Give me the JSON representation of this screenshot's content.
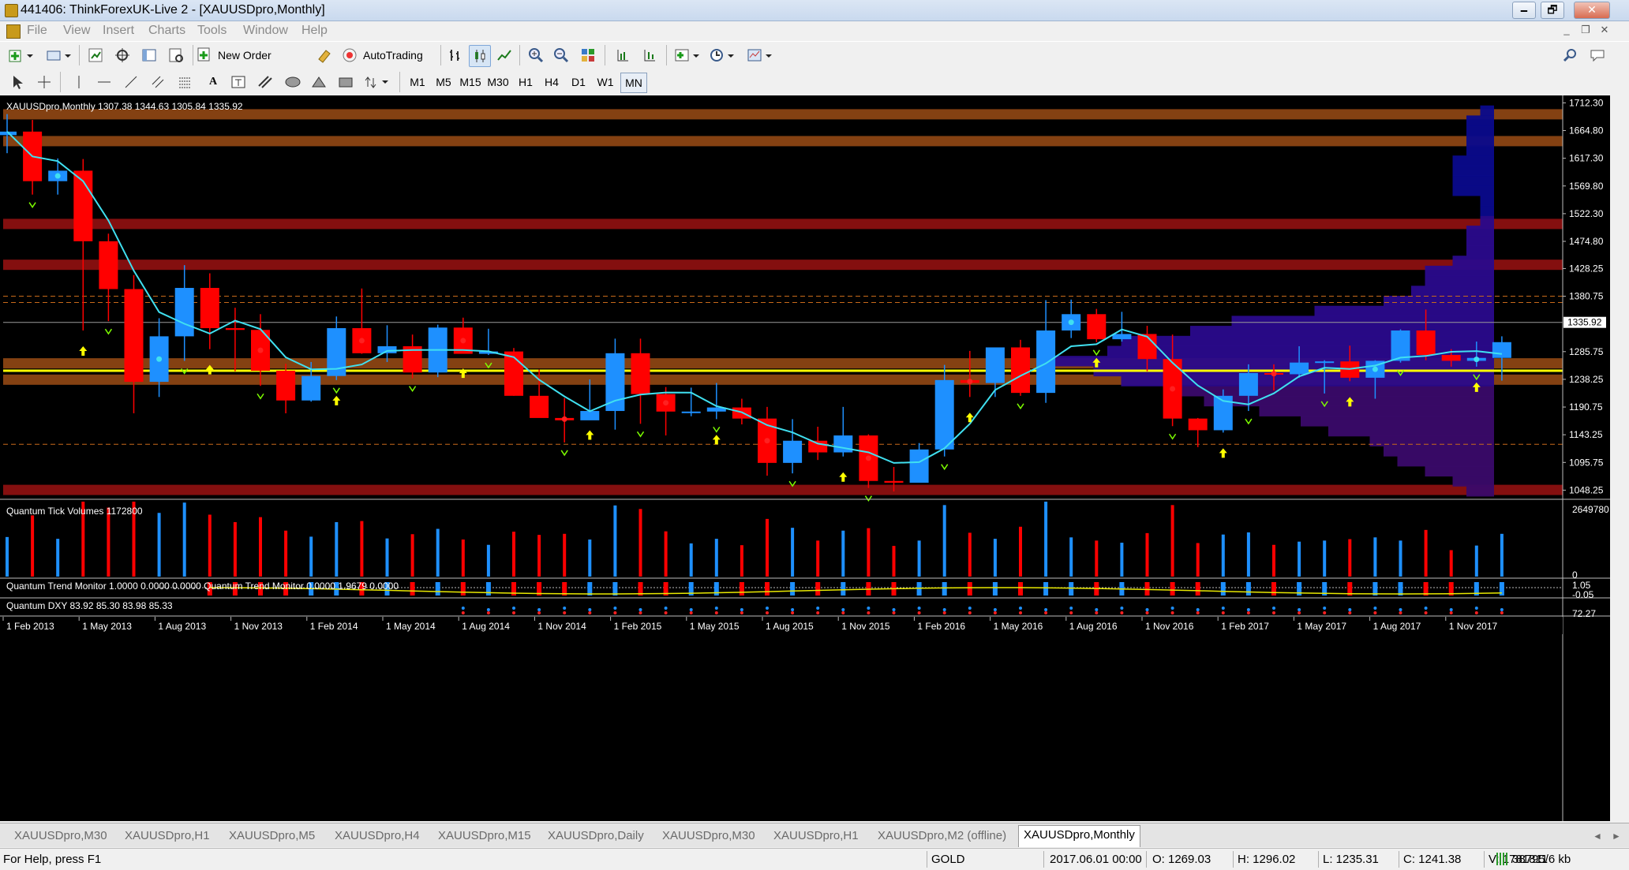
{
  "window": {
    "title": "441406: ThinkForexUK-Live 2 - [XAUUSDpro,Monthly]",
    "min": "🗕",
    "restore": "🗗",
    "close": "✕"
  },
  "menu": [
    "File",
    "View",
    "Insert",
    "Charts",
    "Tools",
    "Window",
    "Help"
  ],
  "toolbar": {
    "new_order": "New Order",
    "autotrading": "AutoTrading"
  },
  "timeframes": [
    "M1",
    "M5",
    "M15",
    "M30",
    "H1",
    "H4",
    "D1",
    "W1",
    "MN"
  ],
  "active_timeframe": "MN",
  "chart": {
    "header": "XAUUSDpro,Monthly  1307.38 1344.63 1305.84 1335.92",
    "current_price": "1335.92",
    "price_ticks": [
      "1712.30",
      "1664.80",
      "1617.30",
      "1569.80",
      "1522.30",
      "1474.80",
      "1428.25",
      "1380.75",
      "1285.75",
      "1238.25",
      "1190.75",
      "1143.25",
      "1095.75",
      "1048.25"
    ],
    "date_labels": [
      "1 Feb 2013",
      "1 May 2013",
      "1 Aug 2013",
      "1 Nov 2013",
      "1 Feb 2014",
      "1 May 2014",
      "1 Aug 2014",
      "1 Nov 2014",
      "1 Feb 2015",
      "1 May 2015",
      "1 Aug 2015",
      "1 Nov 2015",
      "1 Feb 2016",
      "1 May 2016",
      "1 Aug 2016",
      "1 Nov 2016",
      "1 Feb 2017",
      "1 May 2017",
      "1 Aug 2017",
      "1 Nov 2017"
    ]
  },
  "indicators": {
    "volume": {
      "label": "Quantum Tick Volumes 1172800",
      "max": "2649780",
      "zero": "0"
    },
    "trend": {
      "label": "Quantum Trend Monitor 1.0000 0.0000 0.0000   Quantum Trend Monitor 0.0000 1.9679 0.0000",
      "hi": "1.05",
      "lo": "-0.05"
    },
    "dxy": {
      "label": "Quantum DXY 83.92 85.30 83.98 85.33",
      "value": "72.27"
    }
  },
  "tabs": [
    "XAUUSDpro,M30",
    "XAUUSDpro,H1",
    "XAUUSDpro,M5",
    "XAUUSDpro,H4",
    "XAUUSDpro,M15",
    "XAUUSDpro,Daily",
    "XAUUSDpro,M30",
    "XAUUSDpro,H1",
    "XAUUSDpro,M2 (offline)",
    "XAUUSDpro,Monthly"
  ],
  "active_tab": 9,
  "status": {
    "help": "For Help, press F1",
    "profile": "GOLD",
    "time": "2017.06.01 00:00",
    "open": "O: 1269.03",
    "high": "H: 1296.02",
    "low": "L: 1235.31",
    "close": "C: 1241.38",
    "volume": "V: 1781811",
    "traffic": "38795/6 kb"
  },
  "chart_data": {
    "type": "candlestick",
    "categories": [
      "Jan 2013",
      "Feb 2013",
      "Mar 2013",
      "Apr 2013",
      "May 2013",
      "Jun 2013",
      "Jul 2013",
      "Aug 2013",
      "Sep 2013",
      "Oct 2013",
      "Nov 2013",
      "Dec 2013",
      "Jan 2014",
      "Feb 2014",
      "Mar 2014",
      "Apr 2014",
      "May 2014",
      "Jun 2014",
      "Jul 2014",
      "Aug 2014",
      "Sep 2014",
      "Oct 2014",
      "Nov 2014",
      "Dec 2014",
      "Jan 2015",
      "Feb 2015",
      "Mar 2015",
      "Apr 2015",
      "May 2015",
      "Jun 2015",
      "Jul 2015",
      "Aug 2015",
      "Sep 2015",
      "Oct 2015",
      "Nov 2015",
      "Dec 2015",
      "Jan 2016",
      "Feb 2016",
      "Mar 2016",
      "Apr 2016",
      "May 2016",
      "Jun 2016",
      "Jul 2016",
      "Aug 2016",
      "Sep 2016",
      "Oct 2016",
      "Nov 2016",
      "Dec 2016",
      "Jan 2017",
      "Feb 2017",
      "Mar 2017",
      "Apr 2017",
      "May 2017",
      "Jun 2017",
      "Jul 2017",
      "Aug 2017",
      "Sep 2017",
      "Oct 2017",
      "Nov 2017",
      "Dec 2017"
    ],
    "open": [
      1657,
      1663,
      1578,
      1596,
      1475,
      1393,
      1234,
      1312,
      1395,
      1326,
      1323,
      1253,
      1202,
      1244,
      1326,
      1283,
      1295,
      1250,
      1327,
      1282,
      1286,
      1210,
      1172,
      1168,
      1184,
      1283,
      1213,
      1183,
      1183,
      1190,
      1171,
      1095,
      1133,
      1113,
      1142,
      1064,
      1061,
      1118,
      1237,
      1232,
      1293,
      1215,
      1322,
      1350,
      1307,
      1316,
      1273,
      1171,
      1151,
      1210,
      1249,
      1247,
      1267,
      1269,
      1241,
      1270,
      1322,
      1280,
      1270,
      1275
    ],
    "high": [
      1693,
      1683,
      1617,
      1616,
      1488,
      1417,
      1343,
      1434,
      1420,
      1361,
      1350,
      1265,
      1268,
      1346,
      1394,
      1331,
      1315,
      1332,
      1344,
      1325,
      1292,
      1255,
      1206,
      1238,
      1308,
      1308,
      1225,
      1224,
      1232,
      1205,
      1191,
      1170,
      1157,
      1191,
      1144,
      1088,
      1129,
      1263,
      1287,
      1270,
      1306,
      1374,
      1375,
      1359,
      1354,
      1330,
      1315,
      1172,
      1221,
      1264,
      1264,
      1295,
      1271,
      1296,
      1271,
      1324,
      1358,
      1290,
      1303,
      1312
    ],
    "low": [
      1626,
      1555,
      1555,
      1322,
      1338,
      1180,
      1208,
      1270,
      1290,
      1252,
      1227,
      1180,
      1200,
      1237,
      1282,
      1268,
      1240,
      1242,
      1284,
      1280,
      1210,
      1182,
      1130,
      1178,
      1152,
      1162,
      1142,
      1175,
      1170,
      1161,
      1073,
      1077,
      1100,
      1106,
      1052,
      1046,
      1072,
      1106,
      1208,
      1208,
      1210,
      1198,
      1309,
      1302,
      1303,
      1252,
      1158,
      1122,
      1147,
      1184,
      1219,
      1241,
      1214,
      1235,
      1205,
      1267,
      1271,
      1260,
      1260,
      1236
    ],
    "close": [
      1663,
      1578,
      1596,
      1475,
      1393,
      1234,
      1312,
      1395,
      1326,
      1323,
      1253,
      1202,
      1244,
      1326,
      1283,
      1295,
      1250,
      1327,
      1282,
      1286,
      1210,
      1172,
      1168,
      1184,
      1283,
      1213,
      1183,
      1183,
      1190,
      1171,
      1095,
      1133,
      1113,
      1142,
      1064,
      1061,
      1118,
      1237,
      1232,
      1293,
      1215,
      1322,
      1350,
      1307,
      1316,
      1273,
      1171,
      1151,
      1210,
      1249,
      1247,
      1267,
      1269,
      1241,
      1270,
      1322,
      1280,
      1270,
      1275,
      1302
    ],
    "support_resistance_bands": [
      1692,
      1646,
      1504,
      1434,
      1265,
      1237,
      1048
    ],
    "pivot_line": 1253,
    "dotted_levels": [
      1380.75,
      1370,
      1127
    ]
  }
}
